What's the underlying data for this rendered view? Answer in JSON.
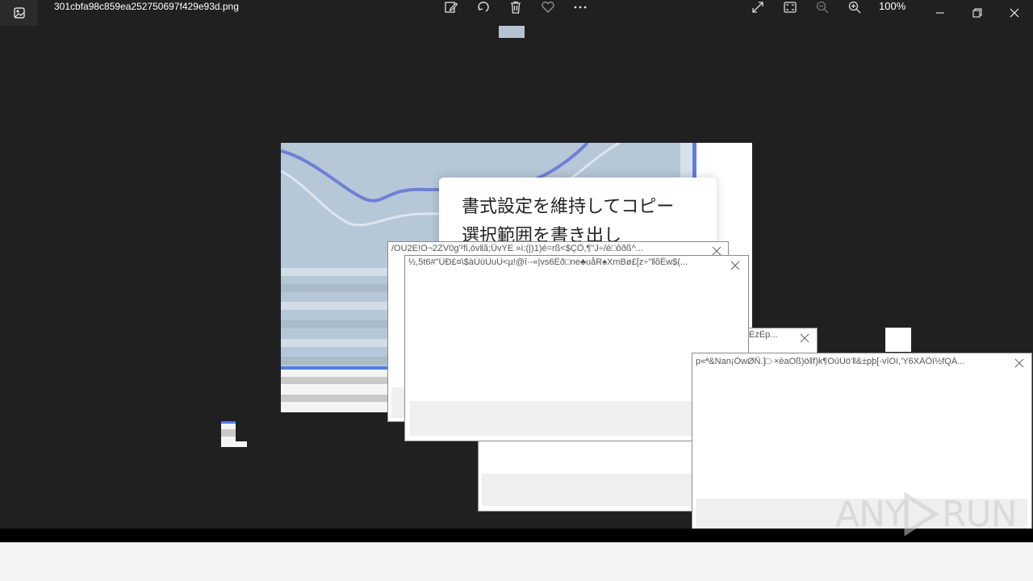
{
  "window": {
    "filename": "301cbfa98c859ea252750697f429e93d.png",
    "zoom": "100%"
  },
  "toolbar": {
    "icons": [
      "edit-icon",
      "rotate-icon",
      "delete-icon",
      "favorite-icon",
      "more-icon",
      "expand-icon",
      "fit-icon",
      "zoom-out-icon",
      "zoom-in-icon"
    ],
    "window_controls": [
      "minimize-icon",
      "restore-icon",
      "close-icon"
    ]
  },
  "image_content": {
    "card_line1": "書式設定を維持してコピー",
    "card_line2": "選択範囲を書き出し"
  },
  "dialogs": [
    {
      "title": "/OÙ2E!Ò¬2ZV0g'²fi,óv‖ã;ǗvÝE »ì:(|)1)é=rß<$ÇÕ,¶\"J÷/é□ôðß^..."
    },
    {
      "title": "½,5t6#\"ÜÐ£¤\\$àÙùÙuÜ<µ!@î·-«|vs6Ëð□ne♣uåR♠XmBø£[z÷\"‖õÊw$(..."
    },
    {
      "title": "ÈzÈp..."
    },
    {
      "title": "p«ª&Nan¡ÕwØÑ.]□·×èaOß)ö‖f)k¶ÒùÜö'‖&±pþ[-vîÒï,'Y6XÄÕï½fQÀ..."
    }
  ],
  "watermark": {
    "text_left": "ANY",
    "text_right": "RUN"
  }
}
